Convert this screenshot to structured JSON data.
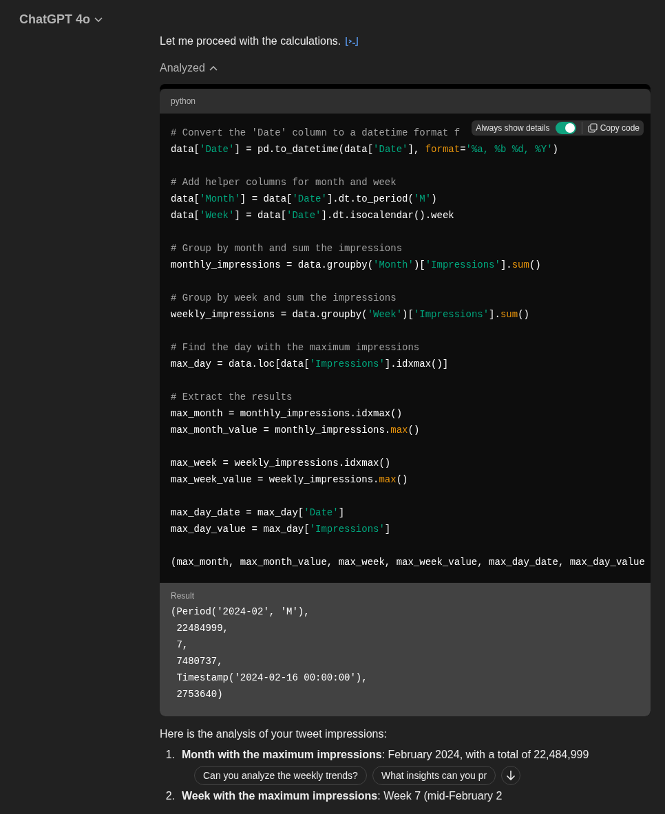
{
  "header": {
    "title": "ChatGPT 4o"
  },
  "intro": "Let me proceed with the calculations.",
  "analysis": {
    "label": "Analyzed",
    "expanded": true
  },
  "code_block": {
    "language": "python",
    "toolbar": {
      "details_label": "Always show details",
      "details_on": true,
      "copy_label": "Copy code"
    },
    "lines": [
      {
        "tokens": [
          {
            "kind": "comment",
            "text": "# Convert the 'Date' column to a datetime format f"
          }
        ]
      },
      {
        "tokens": [
          {
            "kind": "plain",
            "text": "data["
          },
          {
            "kind": "string",
            "text": "'Date'"
          },
          {
            "kind": "plain",
            "text": "] = pd.to_datetime(data["
          },
          {
            "kind": "string",
            "text": "'Date'"
          },
          {
            "kind": "plain",
            "text": "], "
          },
          {
            "kind": "keyword",
            "text": "format"
          },
          {
            "kind": "plain",
            "text": "="
          },
          {
            "kind": "string",
            "text": "'%a, %b %d, %Y'"
          },
          {
            "kind": "plain",
            "text": ")"
          }
        ]
      },
      {
        "kind": "blank"
      },
      {
        "tokens": [
          {
            "kind": "comment",
            "text": "# Add helper columns for month and week"
          }
        ]
      },
      {
        "tokens": [
          {
            "kind": "plain",
            "text": "data["
          },
          {
            "kind": "string",
            "text": "'Month'"
          },
          {
            "kind": "plain",
            "text": "] = data["
          },
          {
            "kind": "string",
            "text": "'Date'"
          },
          {
            "kind": "plain",
            "text": "].dt.to_period("
          },
          {
            "kind": "string",
            "text": "'M'"
          },
          {
            "kind": "plain",
            "text": ")"
          }
        ]
      },
      {
        "tokens": [
          {
            "kind": "plain",
            "text": "data["
          },
          {
            "kind": "string",
            "text": "'Week'"
          },
          {
            "kind": "plain",
            "text": "] = data["
          },
          {
            "kind": "string",
            "text": "'Date'"
          },
          {
            "kind": "plain",
            "text": "].dt.isocalendar().week"
          }
        ]
      },
      {
        "kind": "blank"
      },
      {
        "tokens": [
          {
            "kind": "comment",
            "text": "# Group by month and sum the impressions"
          }
        ]
      },
      {
        "tokens": [
          {
            "kind": "plain",
            "text": "monthly_impressions = data.groupby("
          },
          {
            "kind": "string",
            "text": "'Month'"
          },
          {
            "kind": "plain",
            "text": ")["
          },
          {
            "kind": "string",
            "text": "'Impressions'"
          },
          {
            "kind": "plain",
            "text": "]."
          },
          {
            "kind": "keyword",
            "text": "sum"
          },
          {
            "kind": "plain",
            "text": "()"
          }
        ]
      },
      {
        "kind": "blank"
      },
      {
        "tokens": [
          {
            "kind": "comment",
            "text": "# Group by week and sum the impressions"
          }
        ]
      },
      {
        "tokens": [
          {
            "kind": "plain",
            "text": "weekly_impressions = data.groupby("
          },
          {
            "kind": "string",
            "text": "'Week'"
          },
          {
            "kind": "plain",
            "text": ")["
          },
          {
            "kind": "string",
            "text": "'Impressions'"
          },
          {
            "kind": "plain",
            "text": "]."
          },
          {
            "kind": "keyword",
            "text": "sum"
          },
          {
            "kind": "plain",
            "text": "()"
          }
        ]
      },
      {
        "kind": "blank"
      },
      {
        "tokens": [
          {
            "kind": "comment",
            "text": "# Find the day with the maximum impressions"
          }
        ]
      },
      {
        "tokens": [
          {
            "kind": "plain",
            "text": "max_day = data.loc[data["
          },
          {
            "kind": "string",
            "text": "'Impressions'"
          },
          {
            "kind": "plain",
            "text": "].idxmax()]"
          }
        ]
      },
      {
        "kind": "blank"
      },
      {
        "tokens": [
          {
            "kind": "comment",
            "text": "# Extract the results"
          }
        ]
      },
      {
        "tokens": [
          {
            "kind": "plain",
            "text": "max_month = monthly_impressions.idxmax()"
          }
        ]
      },
      {
        "tokens": [
          {
            "kind": "plain",
            "text": "max_month_value = monthly_impressions."
          },
          {
            "kind": "keyword",
            "text": "max"
          },
          {
            "kind": "plain",
            "text": "()"
          }
        ]
      },
      {
        "kind": "blank"
      },
      {
        "tokens": [
          {
            "kind": "plain",
            "text": "max_week = weekly_impressions.idxmax()"
          }
        ]
      },
      {
        "tokens": [
          {
            "kind": "plain",
            "text": "max_week_value = weekly_impressions."
          },
          {
            "kind": "keyword",
            "text": "max"
          },
          {
            "kind": "plain",
            "text": "()"
          }
        ]
      },
      {
        "kind": "blank"
      },
      {
        "tokens": [
          {
            "kind": "plain",
            "text": "max_day_date = max_day["
          },
          {
            "kind": "string",
            "text": "'Date'"
          },
          {
            "kind": "plain",
            "text": "]"
          }
        ]
      },
      {
        "tokens": [
          {
            "kind": "plain",
            "text": "max_day_value = max_day["
          },
          {
            "kind": "string",
            "text": "'Impressions'"
          },
          {
            "kind": "plain",
            "text": "]"
          }
        ]
      },
      {
        "kind": "blank"
      },
      {
        "tokens": [
          {
            "kind": "plain",
            "text": "(max_month, max_month_value, max_week, max_week_value, max_day_date, max_day_value"
          }
        ]
      }
    ],
    "result": {
      "label": "Result",
      "lines": [
        "(Period('2024-02', 'M'),",
        " 22484999,",
        " 7,",
        " 7480737,",
        " Timestamp('2024-02-16 00:00:00'),",
        " 2753640)"
      ]
    }
  },
  "summary": "Here is the analysis of your tweet impressions:",
  "findings": [
    {
      "number": "1.",
      "text": "**Month with the maximum impressions**: February 2024, with a total of 22,484,999"
    },
    {
      "number": "2.",
      "text": "**Week with the maximum impressions**: Week 7 (mid-February 2"
    }
  ],
  "suggestions": [
    "Can you analyze the weekly trends?",
    "What insights can you pr"
  ]
}
